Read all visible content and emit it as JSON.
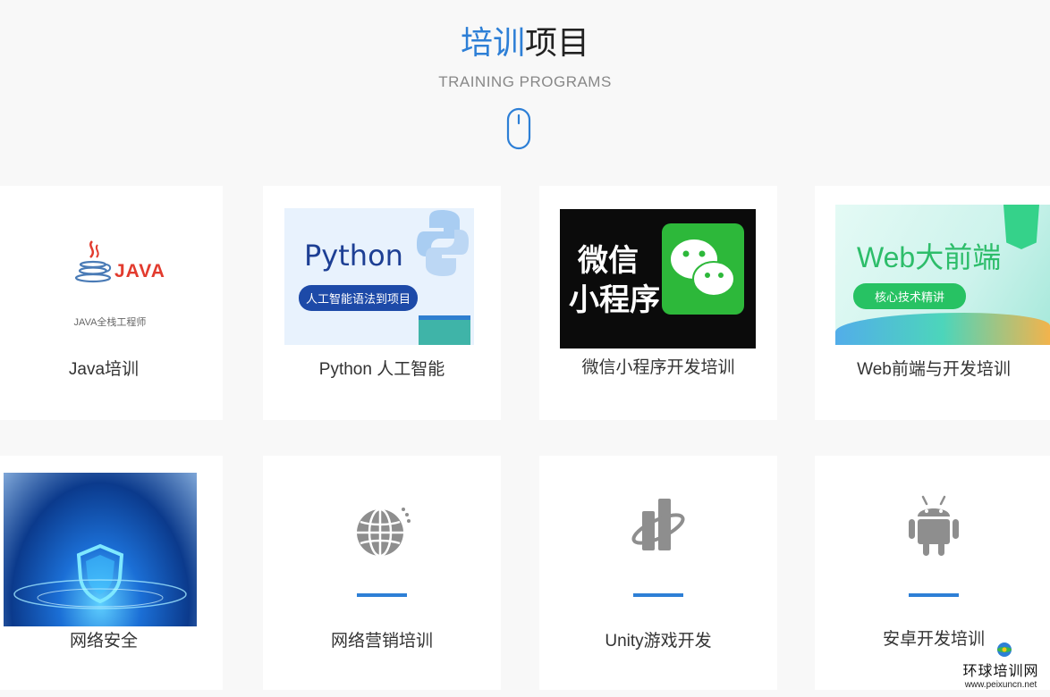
{
  "header": {
    "title_highlight": "培训",
    "title_rest": "项目",
    "subtitle": "TRAINING PROGRAMS"
  },
  "cards": [
    {
      "label": "Java培训",
      "thumb": {
        "logo_text": "JAVA",
        "caption": "JAVA全栈工程师"
      }
    },
    {
      "label": "Python 人工智能",
      "thumb": {
        "heading": "Python",
        "pill": "人工智能语法到项目"
      }
    },
    {
      "label": "微信小程序开发培训",
      "thumb": {
        "line1": "微信",
        "line2": "小程序"
      }
    },
    {
      "label": "Web前端与开发培训",
      "thumb": {
        "heading": "Web大前端",
        "pill": "核心技术精讲"
      }
    },
    {
      "label": "网络安全"
    },
    {
      "label": "网络营销培训",
      "icon": "globe-icon"
    },
    {
      "label": "Unity游戏开发",
      "icon": "unity-icon"
    },
    {
      "label": "安卓开发培训",
      "icon": "android-icon"
    }
  ],
  "watermark": {
    "name": "环球培训网",
    "url": "www.peixuncn.net"
  },
  "colors": {
    "accent": "#2d7fd6",
    "icon_gray": "#8e8e8e",
    "background": "#f8f8f8"
  }
}
